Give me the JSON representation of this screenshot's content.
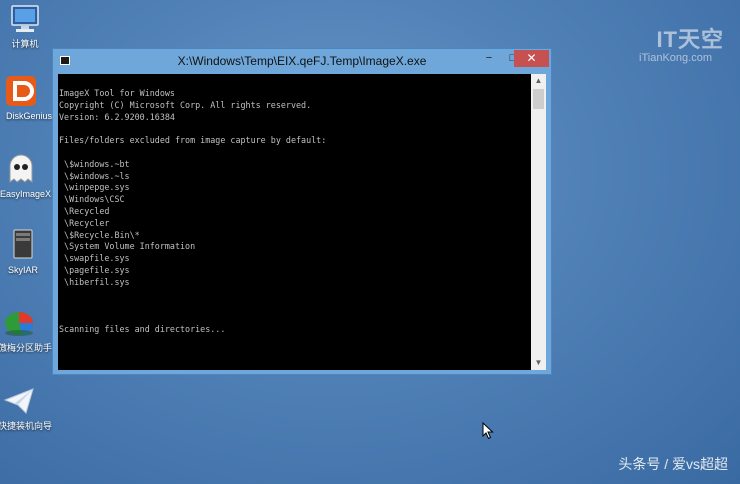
{
  "desktop": {
    "icons": [
      {
        "label": "计算机",
        "icon": "computer-icon"
      },
      {
        "label": "DiskGenius",
        "icon": "diskgenius-icon"
      },
      {
        "label": "EasyImageX",
        "icon": "easyimagex-icon"
      },
      {
        "label": "SkyIAR",
        "icon": "skyiar-icon"
      },
      {
        "label": "傲梅分区助手",
        "icon": "partition-assistant-icon"
      },
      {
        "label": "快捷装机向导",
        "icon": "install-wizard-icon"
      }
    ],
    "watermark_logo": "IT天空",
    "watermark_site": "iTianKong.com",
    "watermark_bottom": "头条号 / 爱vs超超"
  },
  "window": {
    "title": "X:\\Windows\\Temp\\EIX.qeFJ.Temp\\ImageX.exe",
    "minimize_glyph": "−",
    "maximize_glyph": "□",
    "close_glyph": "✕",
    "console_lines": [
      "ImageX Tool for Windows",
      "Copyright (C) Microsoft Corp. All rights reserved.",
      "Version: 6.2.9200.16384",
      "",
      "Files/folders excluded from image capture by default:",
      "",
      " \\$windows.~bt",
      " \\$windows.~ls",
      " \\winpepge.sys",
      " \\Windows\\CSC",
      " \\Recycled",
      " \\Recycler",
      " \\$Recycle.Bin\\*",
      " \\System Volume Information",
      " \\swapfile.sys",
      " \\pagefile.sys",
      " \\hiberfil.sys",
      "",
      "",
      "",
      "Scanning files and directories..."
    ]
  },
  "colors": {
    "desktop": "#5a8cc0",
    "window_frame": "#6fa7da",
    "close_button": "#c75050",
    "console_bg": "#000000",
    "console_text": "#c0c0c0"
  }
}
